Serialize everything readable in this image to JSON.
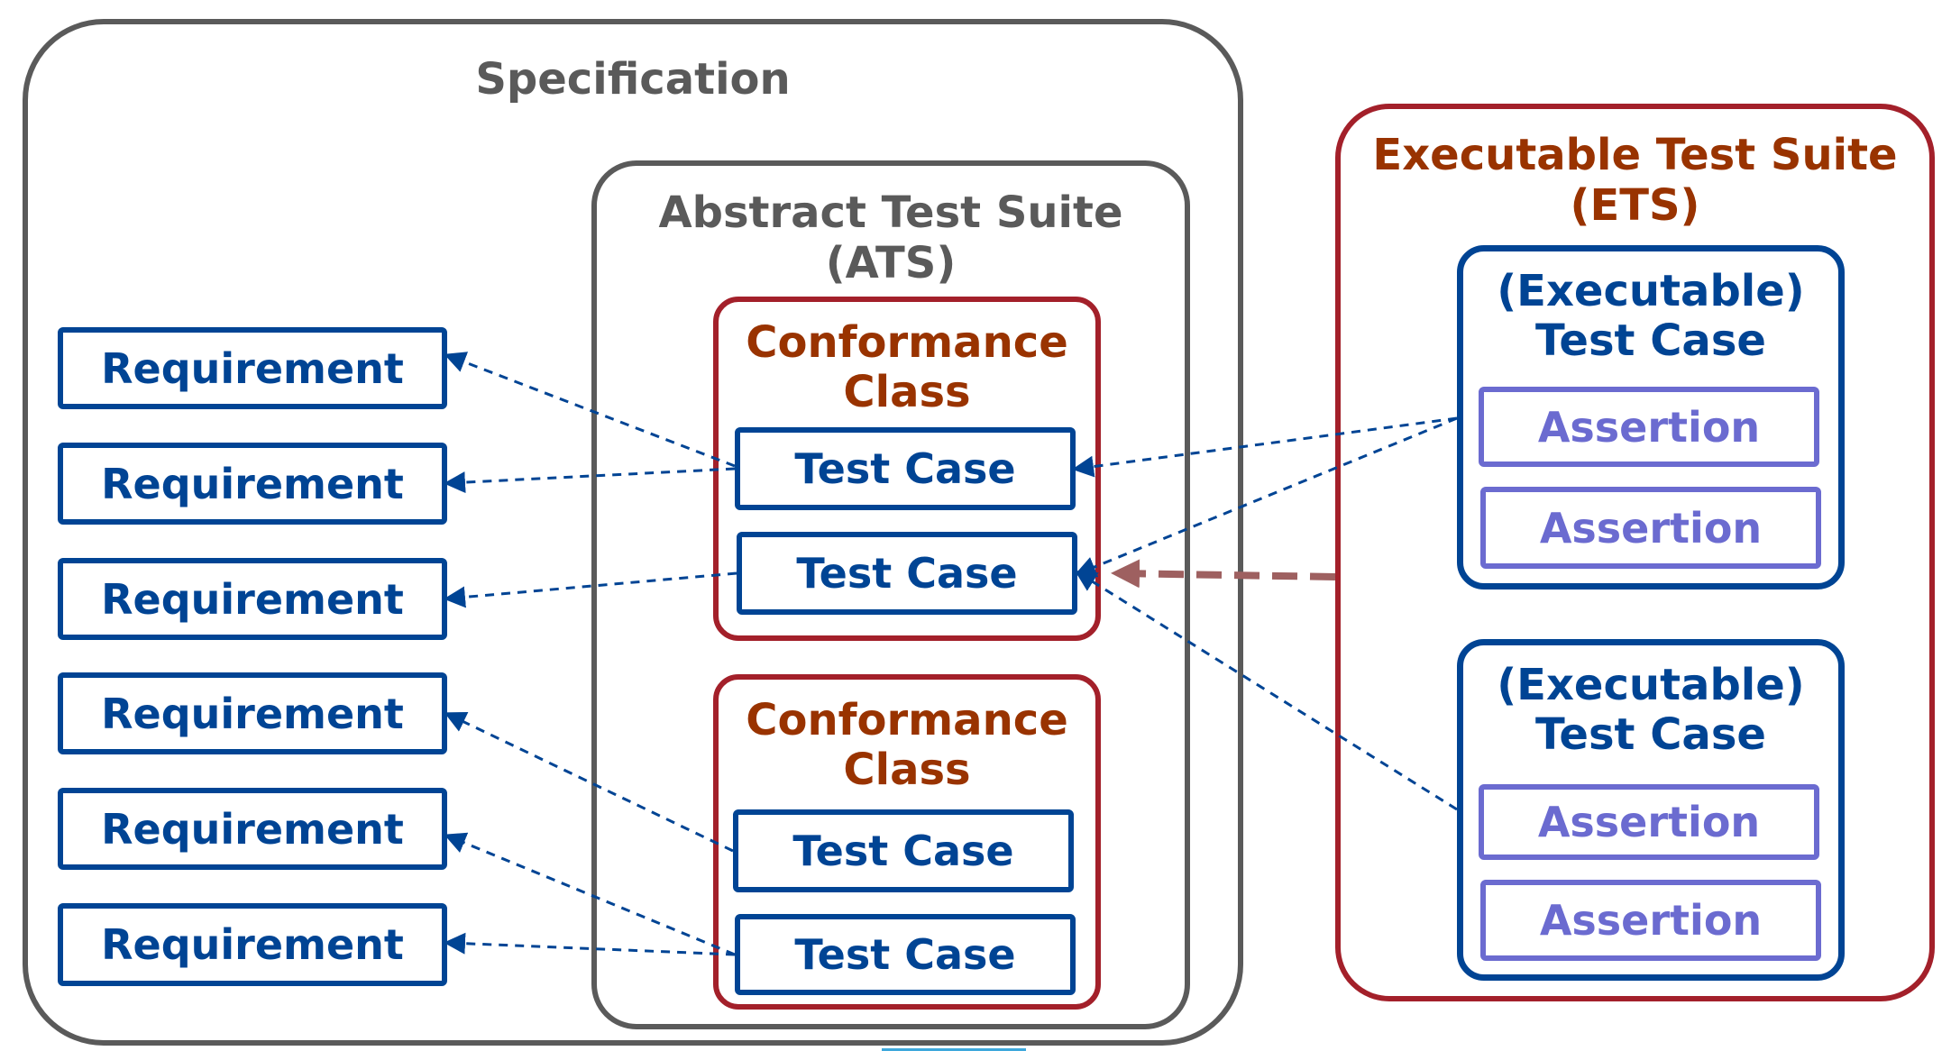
{
  "specification": {
    "title": "Specification"
  },
  "ats": {
    "title_line1": "Abstract Test Suite",
    "title_line2": "(ATS)",
    "conformance_classes": [
      {
        "title_line1": "Conformance",
        "title_line2": "Class",
        "test_cases": [
          "Test Case",
          "Test Case"
        ]
      },
      {
        "title_line1": "Conformance",
        "title_line2": "Class",
        "test_cases": [
          "Test Case",
          "Test Case"
        ]
      }
    ]
  },
  "requirements": [
    "Requirement",
    "Requirement",
    "Requirement",
    "Requirement",
    "Requirement",
    "Requirement"
  ],
  "ets": {
    "title_line1": "Executable Test Suite",
    "title_line2": "(ETS)",
    "test_cases": [
      {
        "title_line1": "(Executable)",
        "title_line2": "Test Case",
        "assertions": [
          "Assertion",
          "Assertion"
        ]
      },
      {
        "title_line1": "(Executable)",
        "title_line2": "Test Case",
        "assertions": [
          "Assertion",
          "Assertion"
        ]
      }
    ]
  },
  "colors": {
    "spec_border": "#5a5a5a",
    "conformance_border": "#a3202a",
    "blue": "#004494",
    "assertion": "#6b6bd0",
    "implements_arrow": "#9e6060"
  }
}
